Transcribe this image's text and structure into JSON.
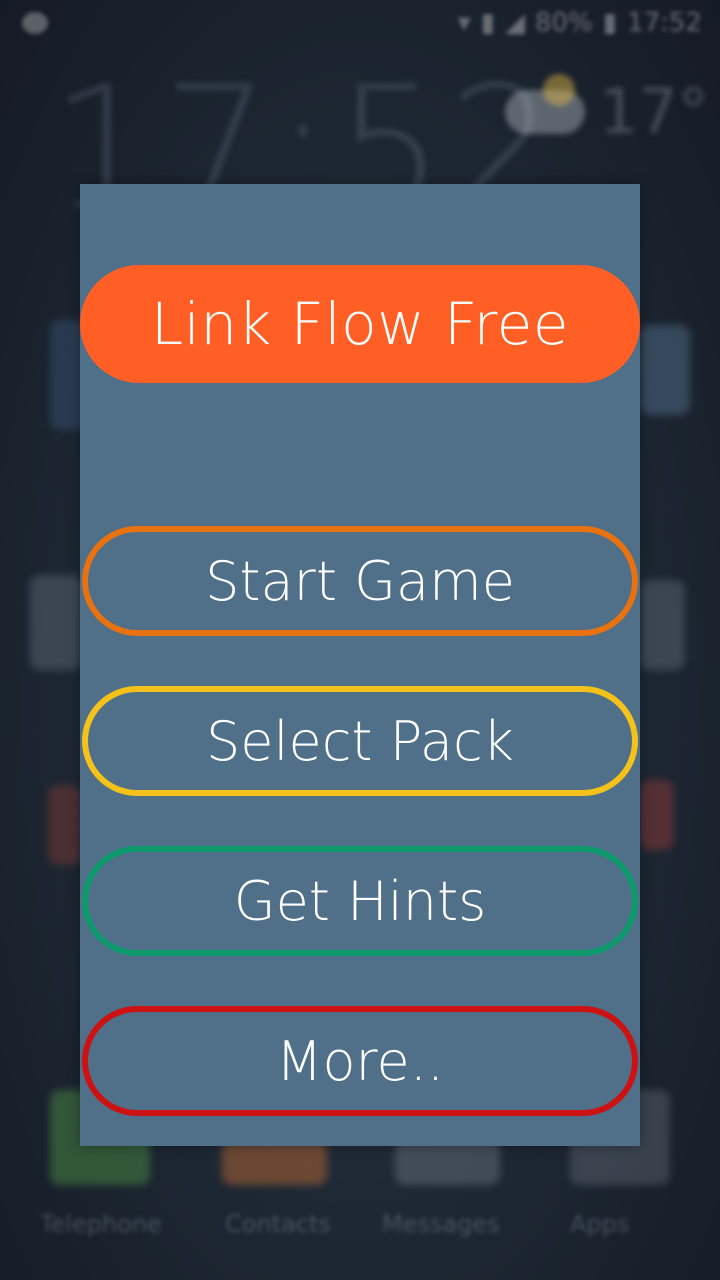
{
  "status_bar": {
    "battery": "80%",
    "time": "17:52"
  },
  "home_screen": {
    "clock": "17:52",
    "temperature": "17°",
    "dock": [
      "Telephone",
      "Contacts",
      "Messages",
      "Apps"
    ]
  },
  "dialog": {
    "title": "Link Flow Free",
    "buttons": [
      {
        "label": "Start Game",
        "color": "#e8720f"
      },
      {
        "label": "Select Pack",
        "color": "#f4c21a"
      },
      {
        "label": "Get Hints",
        "color": "#0f9a6e"
      },
      {
        "label": "More..",
        "color": "#cc1212"
      }
    ],
    "background_color": "#4f7088",
    "title_color": "#ff5f24"
  }
}
